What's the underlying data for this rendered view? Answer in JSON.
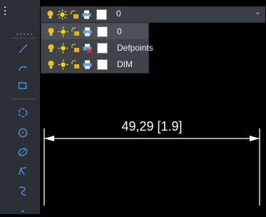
{
  "current_layer": {
    "name": "0"
  },
  "layers": [
    {
      "name": "0",
      "selected": true,
      "plot": "printer-icon"
    },
    {
      "name": "Defpoints",
      "selected": false,
      "plot": "no-plot-printer-icon"
    },
    {
      "name": "DIM",
      "selected": false,
      "plot": "printer-icon"
    }
  ],
  "dimension": {
    "text": "49,29  [1.9]"
  },
  "colors": {
    "toolbar": "#2b3036",
    "combo": "#3a3f46",
    "dropdown": "#3f444b",
    "icon": "#4f86c6",
    "bulb": "#f2c400",
    "sun": "#f2d200",
    "canvas": "#000000"
  },
  "toolbar_icons": [
    "line-icon",
    "arc-icon",
    "rectangle-icon",
    "revcloud-icon",
    "circle-icon",
    "ellipse-icon",
    "spline-icon",
    "polyline-icon"
  ]
}
